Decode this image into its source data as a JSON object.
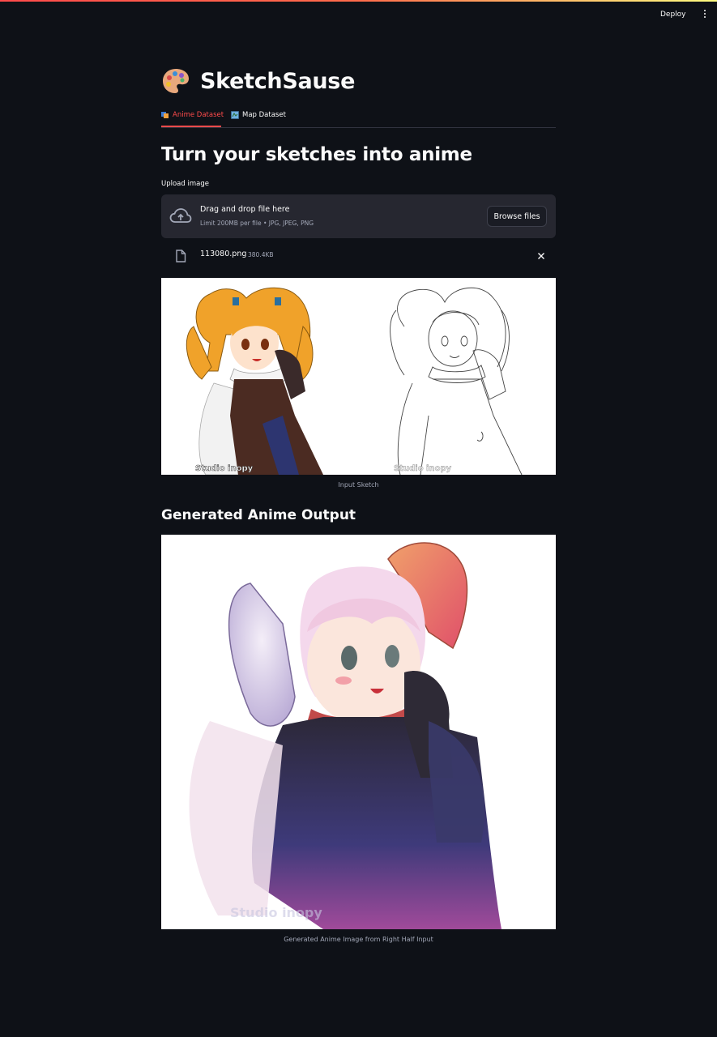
{
  "header": {
    "deploy_label": "Deploy",
    "accent_colors": [
      "#ff4b4b",
      "#fffd80"
    ]
  },
  "app": {
    "title": "SketchSause",
    "icon": "artist-palette-icon"
  },
  "tabs": [
    {
      "label": "Anime Dataset",
      "icon": "anime-emoji-icon",
      "active": true
    },
    {
      "label": "Map Dataset",
      "icon": "map-emoji-icon",
      "active": false
    }
  ],
  "main": {
    "heading": "Turn your sketches into anime",
    "upload_label": "Upload image",
    "dropzone": {
      "title": "Drag and drop file here",
      "limit": "Limit 200MB per file • JPG, JPEG, PNG",
      "browse_label": "Browse files",
      "icon": "cloud-upload-icon"
    },
    "uploaded_file": {
      "name": "113080.png",
      "size": "380.4KB",
      "icon": "file-icon"
    },
    "input_image": {
      "caption": "Input Sketch",
      "watermark": "Studio inopy"
    },
    "output_heading": "Generated Anime Output",
    "output_image": {
      "caption": "Generated Anime Image from Right Half Input"
    }
  },
  "colors": {
    "background": "#0e1117",
    "accent": "#ff4b4b",
    "panel": "#262730",
    "muted_text": "#a3a8b8"
  }
}
